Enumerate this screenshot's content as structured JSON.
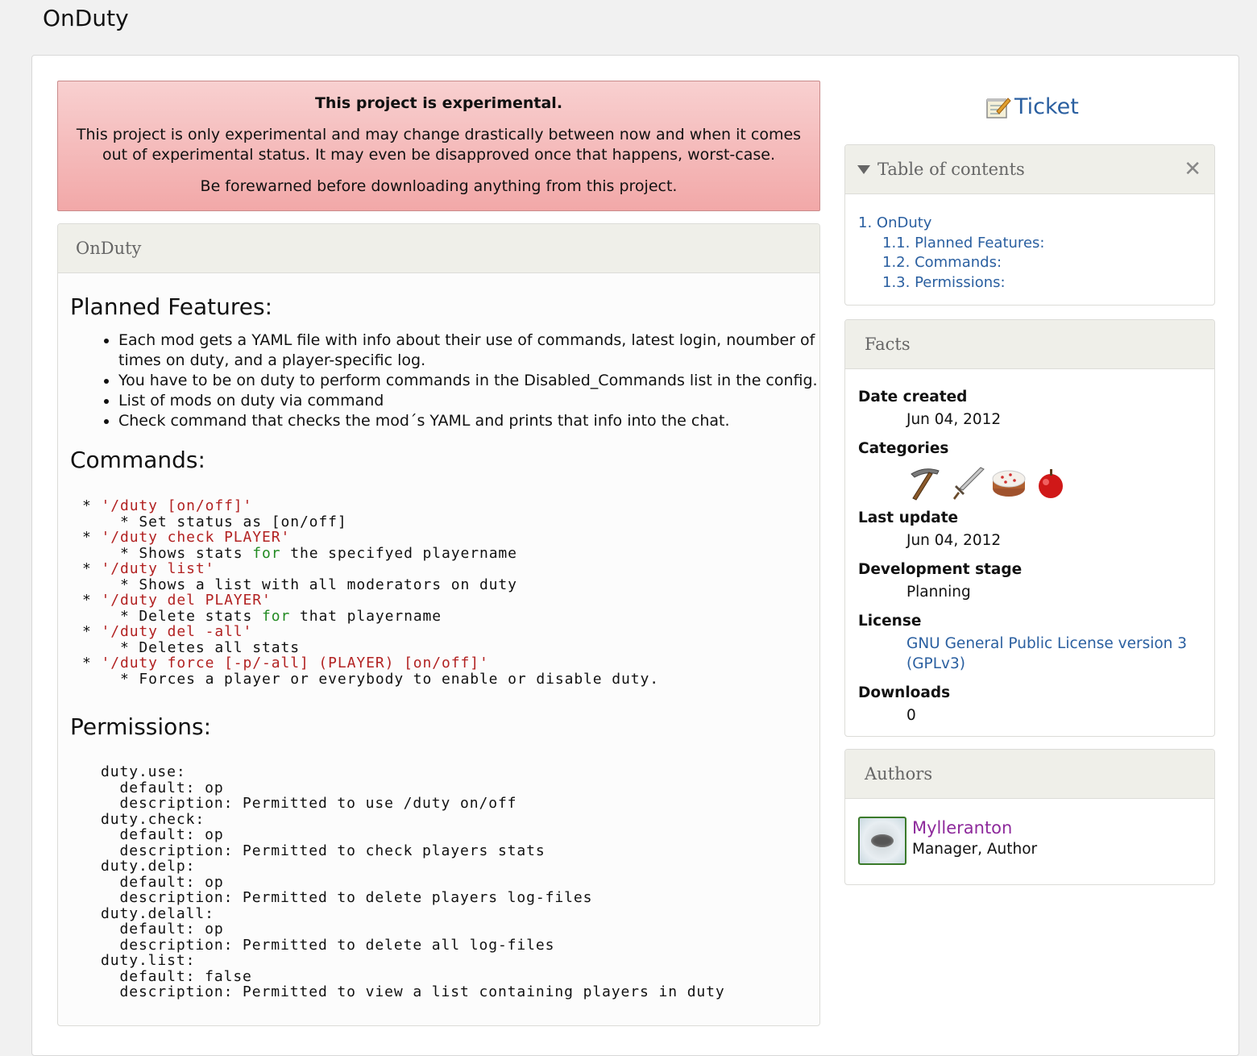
{
  "page": {
    "title": "OnDuty"
  },
  "warning": {
    "title": "This project is experimental.",
    "body": "This project is only experimental and may change drastically between now and when it comes out of experimental status. It may even be disapproved once that happens, worst-case.",
    "footer": "Be forewarned before downloading anything from this project."
  },
  "main": {
    "panel_title": "OnDuty",
    "features_heading": "Planned Features:",
    "features": [
      "Each mod gets a YAML file with info about their use of commands, latest login, noumber of times on duty, and a player-specific log.",
      "You have to be on duty to perform commands in the Disabled_Commands list in the config.",
      "List of mods on duty via command",
      "Check command that checks the mod´s YAML and prints that info into the chat."
    ],
    "commands_heading": "Commands:",
    "commands": [
      {
        "cmd": "'/duty [on/off]'",
        "desc_pre": "Set status as [on/off]",
        "kw": "",
        "desc_post": ""
      },
      {
        "cmd": "'/duty check PLAYER'",
        "desc_pre": "Shows stats ",
        "kw": "for",
        "desc_post": " the specifyed playername"
      },
      {
        "cmd": "'/duty list'",
        "desc_pre": "Shows a list with all moderators on duty",
        "kw": "",
        "desc_post": ""
      },
      {
        "cmd": "'/duty del PLAYER'",
        "desc_pre": "Delete stats ",
        "kw": "for",
        "desc_post": " that playername"
      },
      {
        "cmd": "'/duty del -all'",
        "desc_pre": "Deletes all stats",
        "kw": "",
        "desc_post": ""
      },
      {
        "cmd": "'/duty force [-p/-all] (PLAYER) [on/off]'",
        "desc_pre": "Forces a player or everybody to enable or disable duty.",
        "kw": "",
        "desc_post": ""
      }
    ],
    "permissions_heading": "Permissions:",
    "permissions_code": "duty.use:\n  default: op\n  description: Permitted to use /duty on/off\nduty.check:\n  default: op\n  description: Permitted to check players stats\nduty.delp:\n  default: op\n  description: Permitted to delete players log-files\nduty.delall:\n  default: op\n  description: Permitted to delete all log-files\nduty.list:\n  default: false\n  description: Permitted to view a list containing players in duty"
  },
  "sidebar": {
    "ticket_label": "Ticket",
    "toc": {
      "title": "Table of contents",
      "close": "✕",
      "items": [
        "1. OnDuty",
        "1.1. Planned Features:",
        "1.2. Commands:",
        "1.3. Permissions:"
      ]
    },
    "facts": {
      "title": "Facts",
      "date_created_label": "Date created",
      "date_created": "Jun 04, 2012",
      "categories_label": "Categories",
      "categories_icons": [
        "pickaxe-icon",
        "sword-icon",
        "cake-icon",
        "apple-icon"
      ],
      "last_update_label": "Last update",
      "last_update": "Jun 04, 2012",
      "stage_label": "Development stage",
      "stage": "Planning",
      "license_label": "License",
      "license": "GNU General Public License version 3 (GPLv3)",
      "downloads_label": "Downloads",
      "downloads": "0"
    },
    "authors": {
      "title": "Authors",
      "name": "Mylleranton",
      "role": "Manager, Author"
    }
  }
}
